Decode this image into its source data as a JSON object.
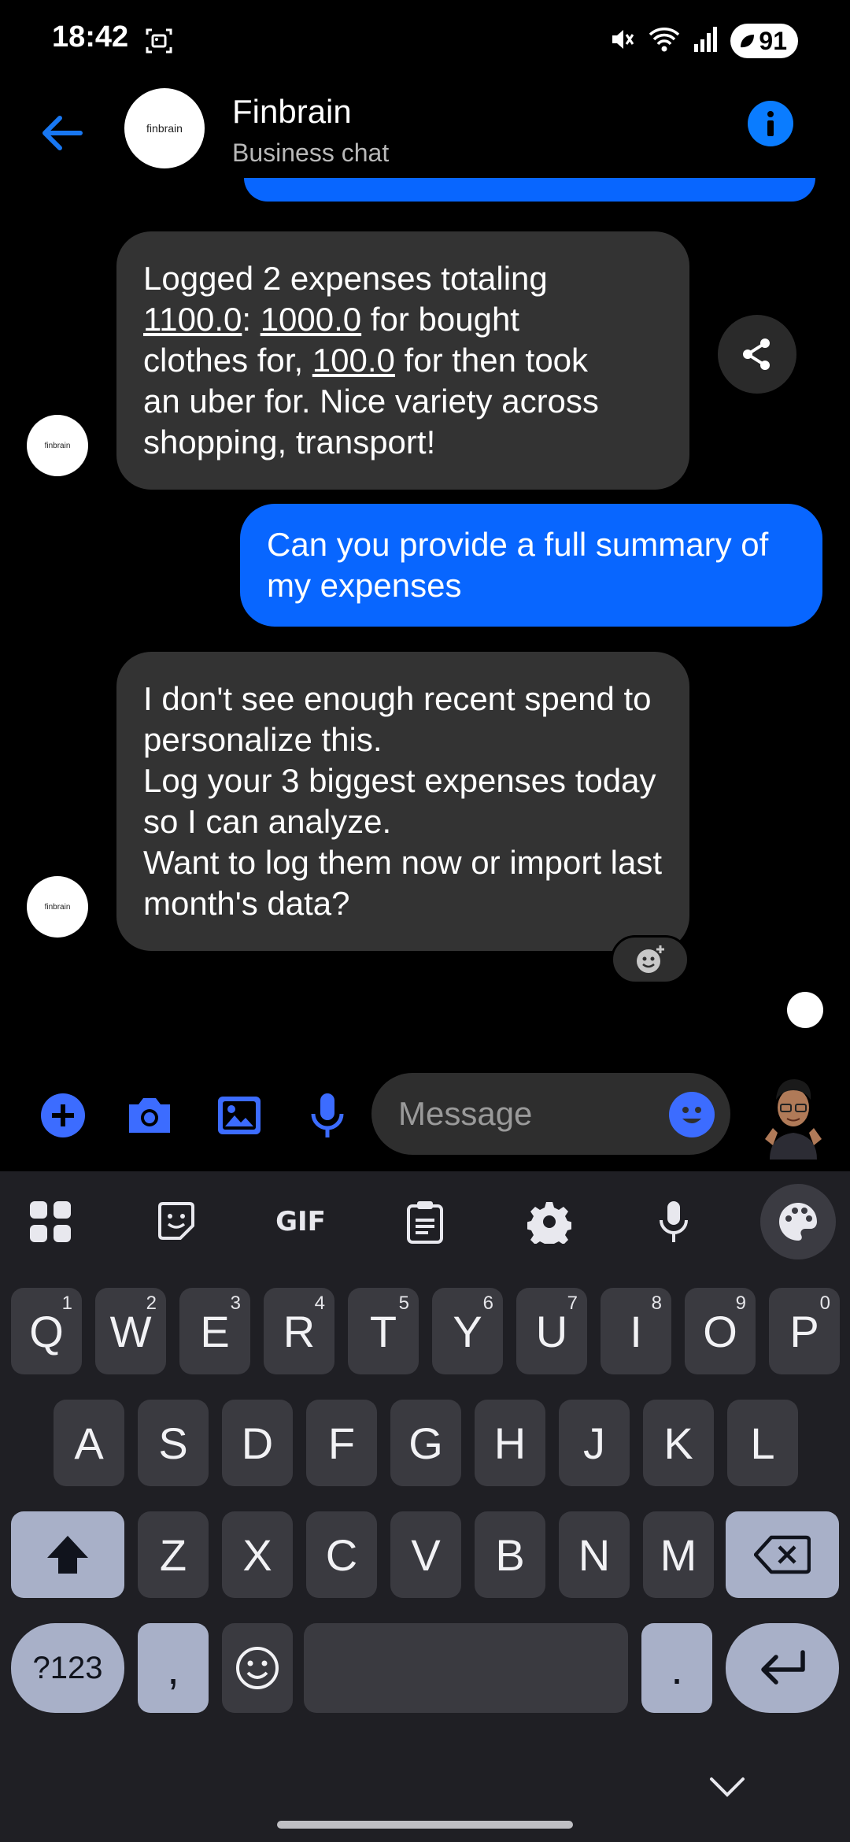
{
  "status_bar": {
    "time": "18:42",
    "battery": "91",
    "icons": [
      "screen-record-icon",
      "mute-icon",
      "wifi-icon",
      "signal-icon",
      "battery-saver-icon"
    ]
  },
  "header": {
    "title": "Finbrain",
    "subtitle": "Business chat",
    "avatar_text": "finbrain"
  },
  "messages": {
    "m1": {
      "line1": "Logged 2 expenses totaling",
      "amount_total": "1100.0",
      "colon": ":",
      "amount_1": "1000.0",
      "text_a": " for bought",
      "text_b": "clothes for, ",
      "amount_2": "100.0",
      "text_c": " for then took",
      "text_d": "an uber for. Nice variety across",
      "text_e": "shopping, transport!"
    },
    "m2": "Can you provide a full summary of my expenses",
    "m3": {
      "p1": "I don't see enough recent spend to personalize this.",
      "p2": "Log your 3 biggest expenses today so I can analyze.",
      "p3": "Want to log them now or import last month's data?"
    },
    "sender_avatar_text": "finbrain"
  },
  "composer": {
    "placeholder": "Message"
  },
  "keyboard": {
    "toolbar": {
      "gif_label": "GIF"
    },
    "row1": [
      {
        "k": "Q",
        "n": "1"
      },
      {
        "k": "W",
        "n": "2"
      },
      {
        "k": "E",
        "n": "3"
      },
      {
        "k": "R",
        "n": "4"
      },
      {
        "k": "T",
        "n": "5"
      },
      {
        "k": "Y",
        "n": "6"
      },
      {
        "k": "U",
        "n": "7"
      },
      {
        "k": "I",
        "n": "8"
      },
      {
        "k": "O",
        "n": "9"
      },
      {
        "k": "P",
        "n": "0"
      }
    ],
    "row2": [
      "A",
      "S",
      "D",
      "F",
      "G",
      "H",
      "J",
      "K",
      "L"
    ],
    "row3": [
      "Z",
      "X",
      "C",
      "V",
      "B",
      "N",
      "M"
    ],
    "symbols_label": "?123",
    "comma": ",",
    "period": "."
  },
  "colors": {
    "accent_blue": "#0866ff",
    "incoming_bubble": "#333333",
    "keyboard_bg": "#1f1f24",
    "key_bg": "#3a3a40",
    "mod_key_bg": "#a8b0c8"
  }
}
